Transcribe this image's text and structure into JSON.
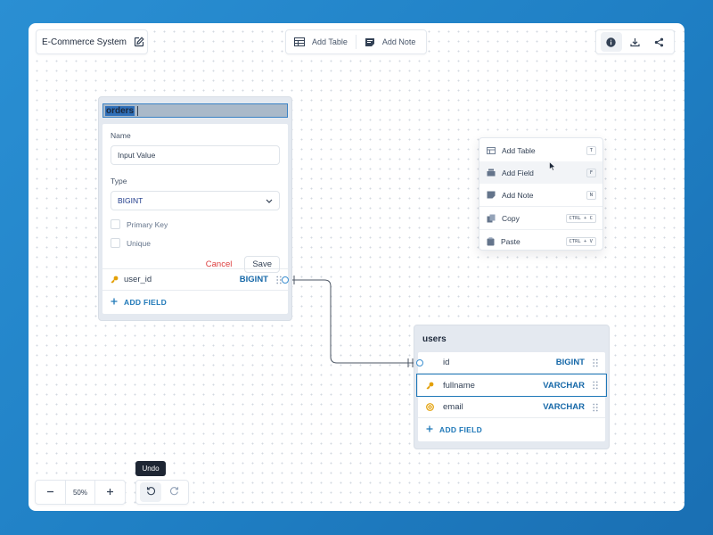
{
  "project": {
    "title": "E-Commerce System"
  },
  "toolbar": {
    "add_table": "Add Table",
    "add_note": "Add Note"
  },
  "orders_table": {
    "name": "orders",
    "editor": {
      "name_label": "Name",
      "name_value": "Input Value",
      "type_label": "Type",
      "type_value": "BIGINT",
      "primary_key_label": "Primary Key",
      "unique_label": "Unique",
      "cancel": "Cancel",
      "save": "Save"
    },
    "fields": [
      {
        "name": "user_id",
        "type": "BIGINT",
        "icon": "key-icon"
      }
    ],
    "add_field": "ADD FIELD"
  },
  "users_table": {
    "name": "users",
    "fields": [
      {
        "name": "id",
        "type": "BIGINT",
        "icon": "none"
      },
      {
        "name": "fullname",
        "type": "VARCHAR",
        "icon": "key-icon"
      },
      {
        "name": "email",
        "type": "VARCHAR",
        "icon": "unique-icon"
      }
    ],
    "add_field": "ADD FIELD"
  },
  "context_menu": {
    "items": [
      {
        "label": "Add Table",
        "shortcut": "T"
      },
      {
        "label": "Add Field",
        "shortcut": "F"
      },
      {
        "label": "Add Note",
        "shortcut": "N"
      },
      {
        "label": "Copy",
        "shortcut": "CTRL + C"
      },
      {
        "label": "Paste",
        "shortcut": "CTRL + V"
      }
    ]
  },
  "zoom": {
    "value": "50%"
  },
  "tooltip": {
    "text": "Undo"
  },
  "colors": {
    "accent": "#1f78b8",
    "danger": "#dc3c3c",
    "key": "#e3a008",
    "background": "#2a8fd3"
  }
}
